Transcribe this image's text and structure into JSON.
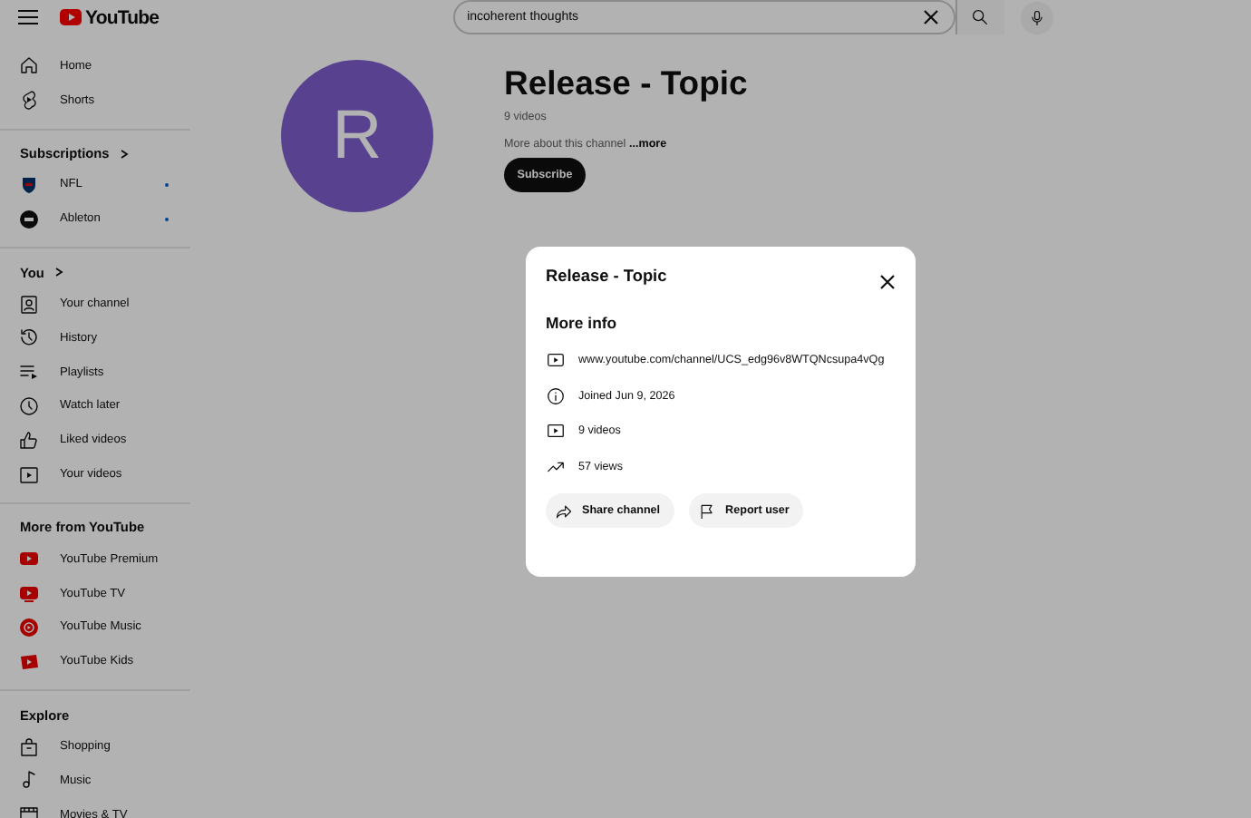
{
  "header": {
    "logo": "YouTube",
    "search": {
      "value": "incoherent thoughts"
    }
  },
  "sidebar": {
    "sections": [
      {
        "items": [
          {
            "label": "Home"
          },
          {
            "label": "Shorts"
          }
        ]
      },
      {
        "heading": "Subscriptions",
        "expandable": true,
        "items": [
          {
            "label": "NFL",
            "new": true
          },
          {
            "label": "Ableton",
            "new": true
          }
        ]
      },
      {
        "heading": "You",
        "expandable": true,
        "items": [
          {
            "label": "Your channel"
          },
          {
            "label": "History"
          },
          {
            "label": "Playlists"
          },
          {
            "label": "Watch later"
          },
          {
            "label": "Liked videos"
          },
          {
            "label": "Your videos"
          }
        ]
      },
      {
        "heading": "More from YouTube",
        "expandable": false,
        "items": [
          {
            "label": "YouTube Premium"
          },
          {
            "label": "YouTube TV"
          },
          {
            "label": "YouTube Music"
          },
          {
            "label": "YouTube Kids"
          }
        ]
      },
      {
        "heading": "Explore",
        "expandable": false,
        "items": [
          {
            "label": "Shopping"
          },
          {
            "label": "Music"
          },
          {
            "label": "Movies & TV"
          }
        ]
      }
    ]
  },
  "channel": {
    "avatar_letter": "R",
    "name": "Release - Topic",
    "video_count": "9 videos",
    "description": "More about this channel",
    "more_link": "...more",
    "subscribe": "Subscribe"
  },
  "modal": {
    "title": "Release - Topic",
    "section_title": "More info",
    "details": [
      {
        "text": "www.youtube.com/channel/UCS_edg96v8WTQNcsupa4vQg"
      },
      {
        "text": "Joined Jun 9, 2026"
      },
      {
        "text": "9 videos"
      },
      {
        "text": "57 views"
      }
    ],
    "buttons": [
      {
        "label": "Share channel"
      },
      {
        "label": "Report user"
      }
    ]
  }
}
